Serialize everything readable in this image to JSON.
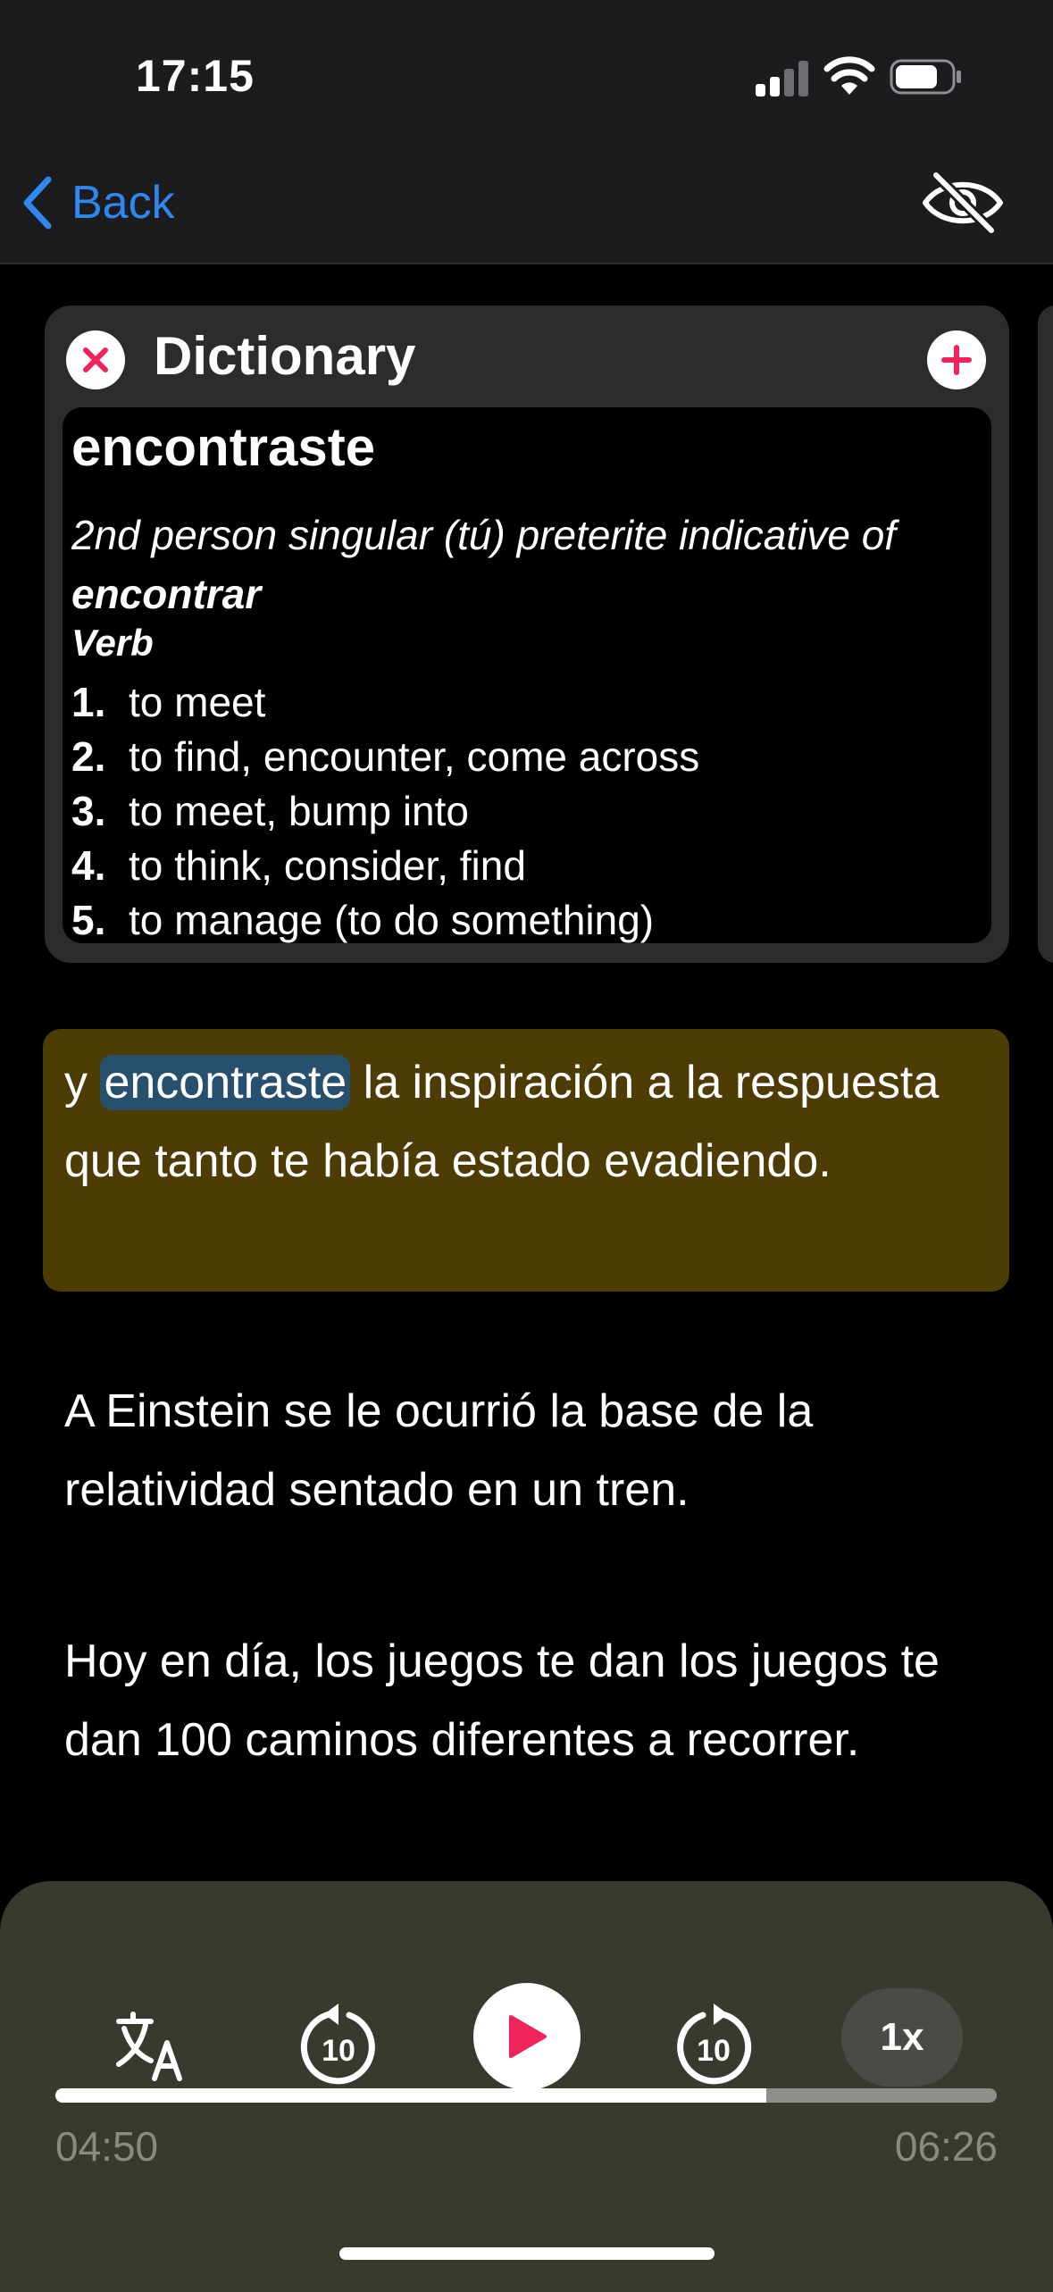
{
  "status_bar": {
    "time": "17:15"
  },
  "nav": {
    "back_label": "Back",
    "back_icon": "chevron-left-icon",
    "hide_icon": "eye-slash-icon"
  },
  "dictionary": {
    "title": "Dictionary",
    "close_icon": "close-icon",
    "add_icon": "plus-icon",
    "word": "encontraste",
    "form_prefix": "2nd person singular (tú) preterite indicative of",
    "lemma": "encontrar",
    "part_of_speech": "Verb",
    "senses": [
      {
        "num": "1.",
        "text": "to meet"
      },
      {
        "num": "2.",
        "text": "to find, encounter, come across"
      },
      {
        "num": "3.",
        "text": "to meet, bump into"
      },
      {
        "num": "4.",
        "text": "to think, consider, find"
      },
      {
        "num": "5.",
        "text": "to manage (to do something)"
      }
    ]
  },
  "transcript": {
    "active": {
      "before": "y",
      "highlight": "encontraste",
      "after": "la inspiración a la respuesta que tanto te había estado evadiendo."
    },
    "paragraphs": [
      "A Einstein se le ocurrió la base de la relatividad sentado en un tren.",
      "Hoy en día, los juegos te dan los juegos te dan 100 caminos diferentes a recorrer."
    ]
  },
  "player": {
    "translate_icon": "translate-icon",
    "rewind_icon": "rewind-10-icon",
    "rewind_label": "10",
    "play_icon": "play-icon",
    "forward_icon": "forward-10-icon",
    "forward_label": "10",
    "speed_label": "1x",
    "progress_fraction": 0.755,
    "elapsed": "04:50",
    "total": "06:26"
  },
  "colors": {
    "accent_blue": "#2f87f0",
    "accent_pink": "#f0245a",
    "active_paragraph_bg": "#4d3c04",
    "word_highlight_bg": "#26506e"
  }
}
